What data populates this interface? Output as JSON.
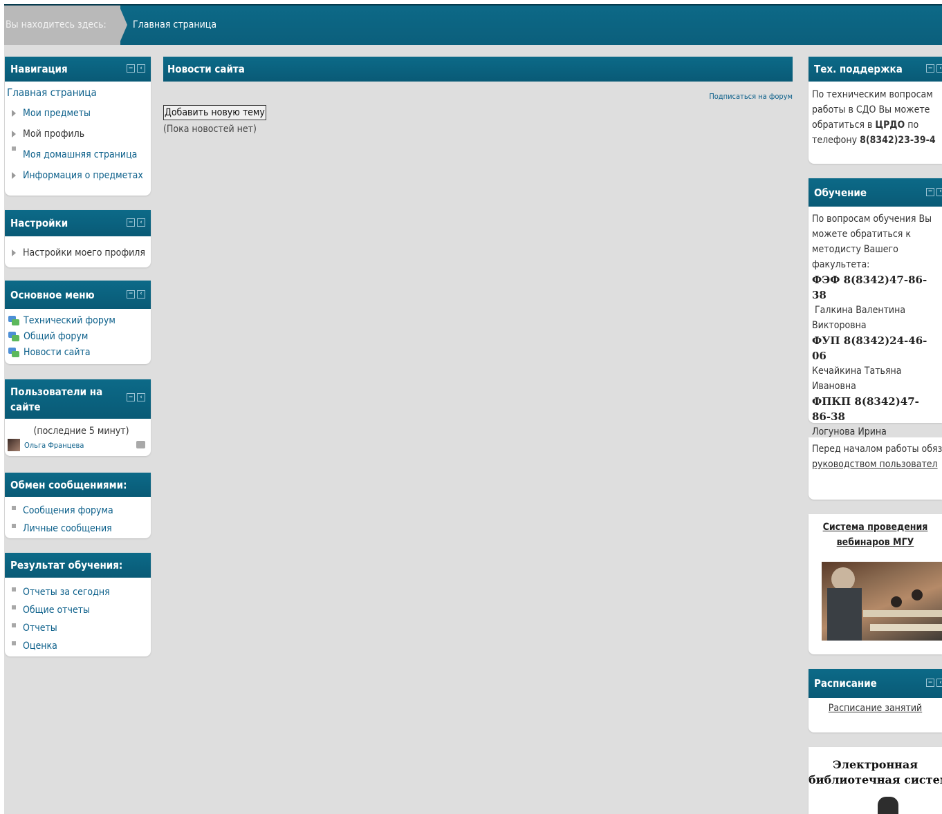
{
  "breadcrumb": {
    "here_label": "Вы находитесь здесь:",
    "home": "Главная страница"
  },
  "navigation": {
    "title": "Навигация",
    "home": "Главная страница",
    "items": [
      {
        "label": "Мои предметы",
        "marker": "triangle",
        "link": true
      },
      {
        "label": "Мой профиль",
        "marker": "triangle",
        "link": false
      },
      {
        "label": "Моя домашняя страница",
        "marker": "square",
        "link": true
      },
      {
        "label": "Информация о предметах",
        "marker": "triangle",
        "link": true
      }
    ]
  },
  "settings": {
    "title": "Настройки",
    "items": [
      "Настройки моего профиля"
    ]
  },
  "main_menu": {
    "title": "Основное меню",
    "items": [
      "Технический форум",
      "Общий форум",
      "Новости сайта"
    ]
  },
  "online_users": {
    "title_line1": "Пользователи на",
    "title_line2": "сайте",
    "period": "(последние 5 минут)",
    "users": [
      "Ольга Францева"
    ]
  },
  "messaging": {
    "title": "Обмен сообщениями:",
    "items": [
      "Сообщения форума",
      "Личные сообщения"
    ]
  },
  "learning_result": {
    "title": "Результат обучения:",
    "items": [
      "Отчеты за сегодня",
      "Общие отчеты",
      "Отчеты",
      "Оценка"
    ]
  },
  "news": {
    "title": "Новости сайта",
    "subscribe": "Подписаться на форум",
    "add_button": "Добавить новую тему",
    "empty": "(Пока новостей нет)"
  },
  "support": {
    "title": "Тех. поддержка",
    "text_1": "По техническим вопросам работы в СДО Вы можете обратиться в ",
    "org": "ЦРДО",
    "text_2": " по телефону ",
    "phone": "8(8342)23-39-4"
  },
  "education": {
    "title": "Обучение",
    "intro": "По вопросам обучения Вы можете обратиться к методисту Вашего факультета:",
    "contacts": [
      {
        "phone": "ФЭФ 8(8342)47-86-38",
        "person": " Галкина Валентина Викторовна"
      },
      {
        "phone": "ФУП 8(8342)24-46-06",
        "person": "Кечайкина Татьяна Ивановна"
      },
      {
        "phone": "ФПКП 8(8342)47-86-38",
        "person": "Логунова Ирина Николаевна"
      }
    ]
  },
  "manual": {
    "text": "Перед началом работы обязательно ознакомьтесь",
    "link": "руководством пользовател"
  },
  "webinar": {
    "title_line1": "Система проведения",
    "title_line2": "вебинаров МГУ"
  },
  "schedule": {
    "title": "Расписание",
    "link": "Расписание занятий"
  },
  "library": {
    "title_line1": "Электронная",
    "title_line2": "библиотечная систем"
  },
  "colors": {
    "header_blue": "#0b5f7c",
    "link_blue": "#0b5f8a",
    "page_bg": "#dedede",
    "crumb_gray": "#b9b9b9"
  }
}
